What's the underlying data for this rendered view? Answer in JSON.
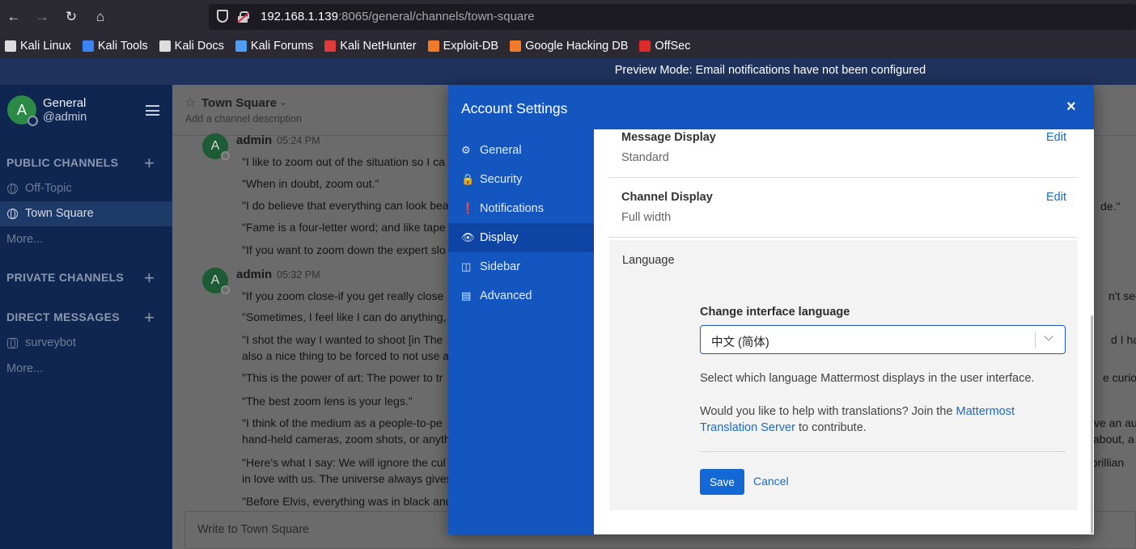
{
  "browser": {
    "url_host": "192.168.1.139",
    "url_rest": ":8065/general/channels/town-square",
    "bookmarks": [
      {
        "label": "Kali Linux",
        "color": "#dddddd"
      },
      {
        "label": "Kali Tools",
        "color": "#3b82f6"
      },
      {
        "label": "Kali Docs",
        "color": "#dddddd"
      },
      {
        "label": "Kali Forums",
        "color": "#4f9ef5"
      },
      {
        "label": "Kali NetHunter",
        "color": "#e03a3a"
      },
      {
        "label": "Exploit-DB",
        "color": "#f07a2a"
      },
      {
        "label": "Google Hacking DB",
        "color": "#f07a2a"
      },
      {
        "label": "OffSec",
        "color": "#e02a2a"
      }
    ]
  },
  "banner": {
    "text": "Preview Mode: Email notifications have not been configured"
  },
  "sidebar": {
    "avatar_letter": "A",
    "team_name": "General",
    "user_handle": "@admin",
    "public_title": "PUBLIC CHANNELS",
    "public_channels": [
      "Off-Topic",
      "Town Square"
    ],
    "more": "More...",
    "private_title": "PRIVATE CHANNELS",
    "dm_title": "DIRECT MESSAGES",
    "dms": [
      "surveybot"
    ]
  },
  "channel": {
    "name": "Town Square",
    "description": "Add a channel description",
    "compose_placeholder": "Write to Town Square",
    "posts": [
      {
        "user": "admin",
        "time": "05:24 PM",
        "avatar": "A",
        "lines": [
          "\"I like to zoom out of the situation so I ca",
          "\"When in doubt, zoom out.\"",
          "\"I do believe that everything can look bea",
          "\"Fame is a four-letter word; and like tape",
          "\"If you want to zoom down the expert slo"
        ],
        "right": [
          "de.\""
        ]
      },
      {
        "user": "admin",
        "time": "05:32 PM",
        "avatar": "A",
        "lines": [
          "\"If you zoom close-if you get really close",
          "\"Sometimes, I feel like I can do anything,",
          "\"I shot the way I wanted to shoot [in The",
          "also a nice thing to be forced to not use a",
          "\"This is the power of art: The power to tr",
          "\"The best zoom lens is your legs.\"",
          "\"I think of the medium as a people-to-pe",
          "hand-held cameras, zoom shots, or anyth",
          "\"Here's what I say: We will ignore the cul",
          "in love with us. The universe always gives",
          "\"Before Elvis, everything was in black and"
        ],
        "right": [
          "n't see a",
          "d I had re",
          "e curiosit",
          "ve an au",
          "about, a",
          "e brillian"
        ]
      }
    ]
  },
  "modal": {
    "title": "Account Settings",
    "close": "×",
    "nav": [
      {
        "label": "General",
        "icon": "gear-icon",
        "glyph": "⚙"
      },
      {
        "label": "Security",
        "icon": "lock-icon",
        "glyph": "🔒"
      },
      {
        "label": "Notifications",
        "icon": "alert-icon",
        "glyph": "❗"
      },
      {
        "label": "Display",
        "icon": "eye-icon",
        "glyph": "👁"
      },
      {
        "label": "Sidebar",
        "icon": "columns-icon",
        "glyph": "◫"
      },
      {
        "label": "Advanced",
        "icon": "list-icon",
        "glyph": "▤"
      }
    ],
    "active_nav": "Display",
    "settings": [
      {
        "label": "Message Display",
        "value": "Standard",
        "edit": "Edit"
      },
      {
        "label": "Channel Display",
        "value": "Full width",
        "edit": "Edit"
      }
    ],
    "language": {
      "title": "Language",
      "subtitle": "Change interface language",
      "selected": "中文 (简体)",
      "help": "Select which language Mattermost displays in the user interface.",
      "trans_prefix": "Would you like to help with translations? Join the ",
      "trans_link": "Mattermost Translation Server",
      "trans_suffix": " to contribute.",
      "save": "Save",
      "cancel": "Cancel"
    }
  }
}
